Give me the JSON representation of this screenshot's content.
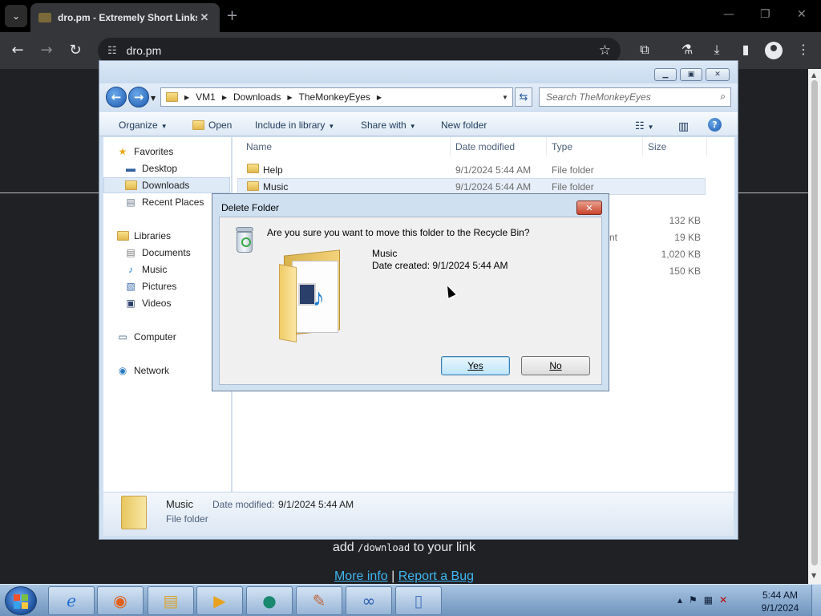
{
  "browser": {
    "tab_title": "dro.pm - Extremely Short Links",
    "url": "dro.pm"
  },
  "page": {
    "download_hint_prefix": "add",
    "download_hint_code": "/download",
    "download_hint_suffix": "to your link",
    "more_info_link": "More info",
    "separator": "|",
    "report_bug_link": "Report a Bug"
  },
  "explorer": {
    "breadcrumb": [
      "VM1",
      "Downloads",
      "TheMonkeyEyes"
    ],
    "search_placeholder": "Search TheMonkeyEyes",
    "commands": {
      "organize": "Organize",
      "open": "Open",
      "include_in_library": "Include in library",
      "share_with": "Share with",
      "new_folder": "New folder"
    },
    "nav_pane": {
      "favorites": "Favorites",
      "desktop": "Desktop",
      "downloads": "Downloads",
      "recent_places": "Recent Places",
      "libraries": "Libraries",
      "documents": "Documents",
      "music": "Music",
      "pictures": "Pictures",
      "videos": "Videos",
      "computer": "Computer",
      "network": "Network"
    },
    "columns": {
      "name": "Name",
      "date_modified": "Date modified",
      "type": "Type",
      "size": "Size"
    },
    "rows": [
      {
        "name": "Help",
        "date": "9/1/2024 5:44 AM",
        "type": "File folder",
        "size": ""
      },
      {
        "name": "Music",
        "date": "9/1/2024 5:44 AM",
        "type": "File folder",
        "size": ""
      },
      {
        "name": "",
        "date": "",
        "type": "",
        "size": "132 KB"
      },
      {
        "name": "",
        "date": "",
        "type": "nt",
        "size": "19 KB"
      },
      {
        "name": "",
        "date": "",
        "type": "",
        "size": "1,020 KB"
      },
      {
        "name": "",
        "date": "",
        "type": "",
        "size": "150 KB"
      }
    ],
    "details": {
      "name": "Music",
      "date_label": "Date modified:",
      "date_value": "9/1/2024 5:44 AM",
      "type": "File folder"
    }
  },
  "dialog": {
    "title": "Delete Folder",
    "question": "Are you sure you want to move this folder to the Recycle Bin?",
    "item_name": "Music",
    "date_created": "Date created: 9/1/2024 5:44 AM",
    "yes_label": "Yes",
    "no_label": "No"
  },
  "taskbar": {
    "time": "5:44 AM",
    "date": "9/1/2024"
  },
  "colors": {
    "chrome_dark": "#202124",
    "link": "#3fb7f2",
    "window_frame": "#cfe0f1",
    "close_red": "#c9442c"
  }
}
